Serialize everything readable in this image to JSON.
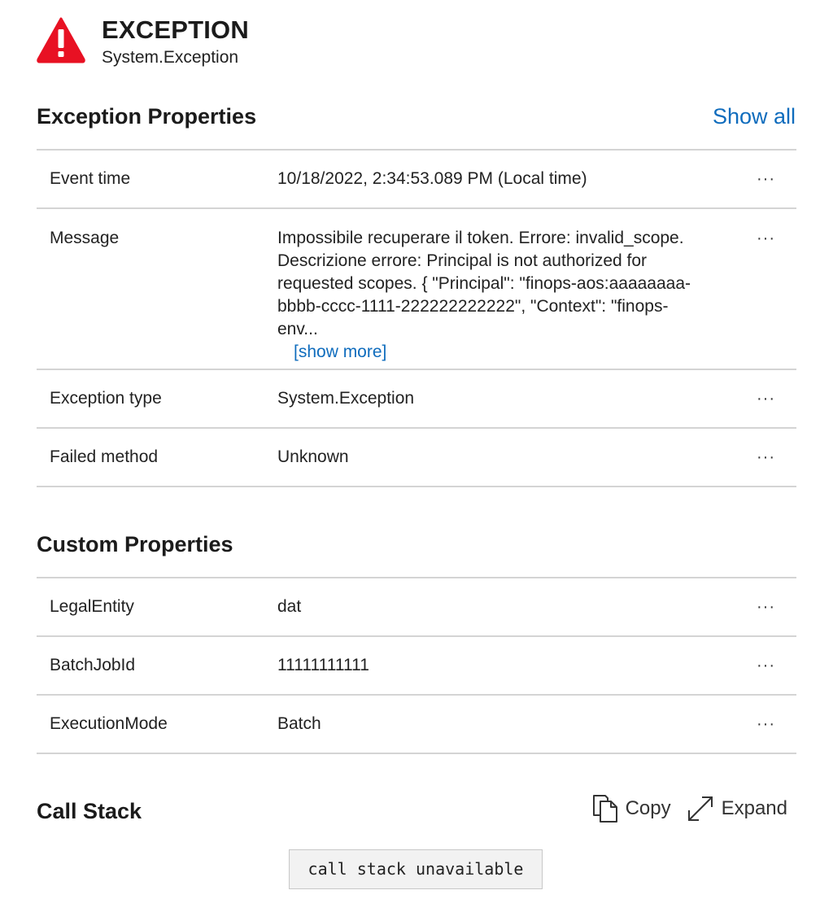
{
  "header": {
    "icon": "warning-icon",
    "icon_color": "#e81123",
    "title": "EXCEPTION",
    "subtitle": "System.Exception"
  },
  "exception_properties": {
    "title": "Exception Properties",
    "show_all_label": "Show all",
    "rows": [
      {
        "key": "Event time",
        "value": "10/18/2022, 2:34:53.089 PM (Local time)"
      },
      {
        "key": "Message",
        "value": "Impossibile recuperare il token. Errore: invalid_scope. Descrizione errore: Principal is not authorized for requested scopes. { \"Principal\": \"finops-aos:aaaaaaaa-bbbb-cccc-1111-222222222222\", \"Context\": \"finops-env...",
        "show_more_label": "[show more]"
      },
      {
        "key": "Exception type",
        "value": "System.Exception"
      },
      {
        "key": "Failed method",
        "value": "Unknown"
      }
    ],
    "more_label": "···"
  },
  "custom_properties": {
    "title": "Custom Properties",
    "rows": [
      {
        "key": "LegalEntity",
        "value": "dat"
      },
      {
        "key": "BatchJobId",
        "value": "11111111111"
      },
      {
        "key": "ExecutionMode",
        "value": "Batch"
      }
    ]
  },
  "call_stack": {
    "title": "Call Stack",
    "copy_label": "Copy",
    "expand_label": "Expand",
    "content": "call stack unavailable"
  },
  "colors": {
    "accent": "#0f6cbd",
    "error": "#e81123",
    "divider": "#d4d4d4"
  }
}
